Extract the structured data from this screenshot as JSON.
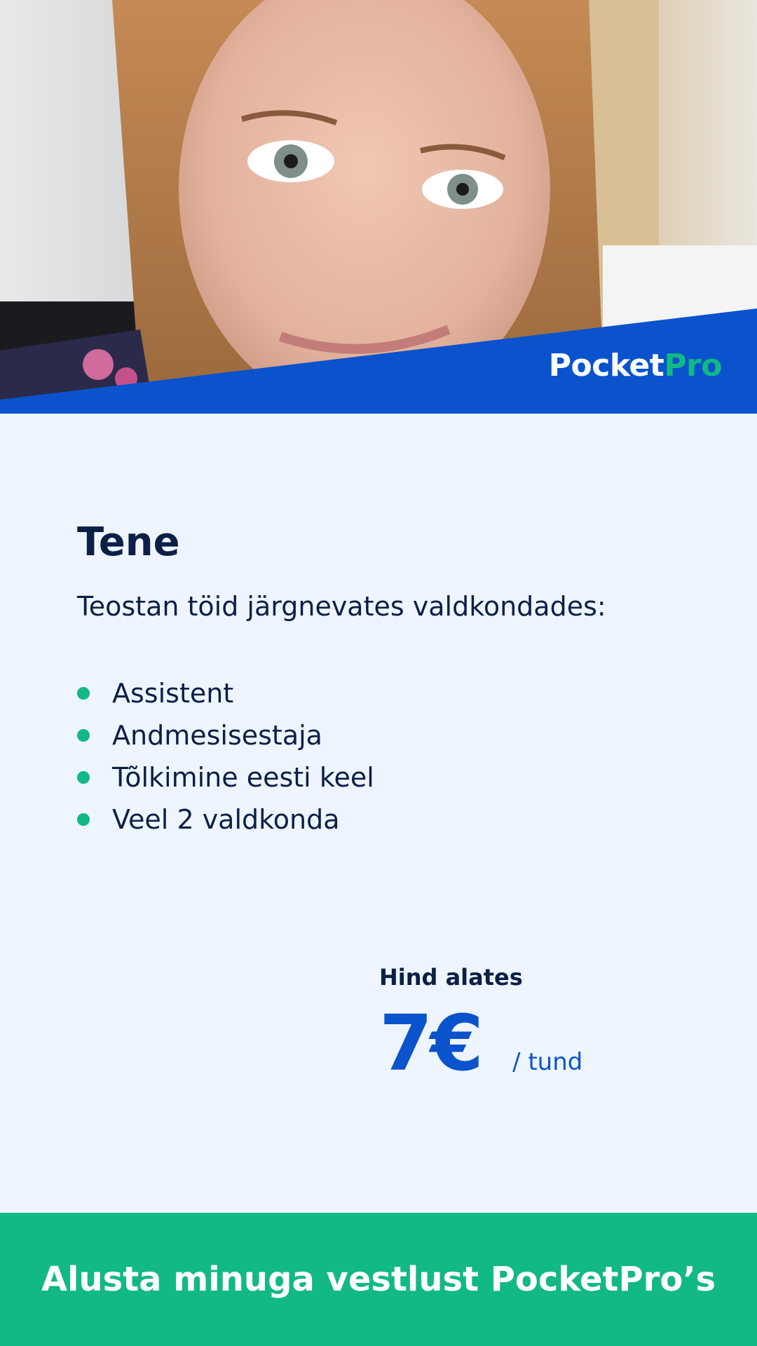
{
  "brand": {
    "part1": "Pocket",
    "part2": "Pro",
    "color_primary": "#0a53cc",
    "color_accent": "#12b886"
  },
  "profile": {
    "name": "Tene",
    "intro": "Teostan töid järgnevates valdkondades:",
    "skills": [
      "Assistent",
      "Andmesisestaja",
      "Tõlkimine eesti keel",
      "Veel 2 valdkonda"
    ]
  },
  "price": {
    "label": "Hind alates",
    "value": "7€",
    "unit": "/ tund"
  },
  "cta": {
    "label": "Alusta minuga vestlust PocketPro’s"
  }
}
